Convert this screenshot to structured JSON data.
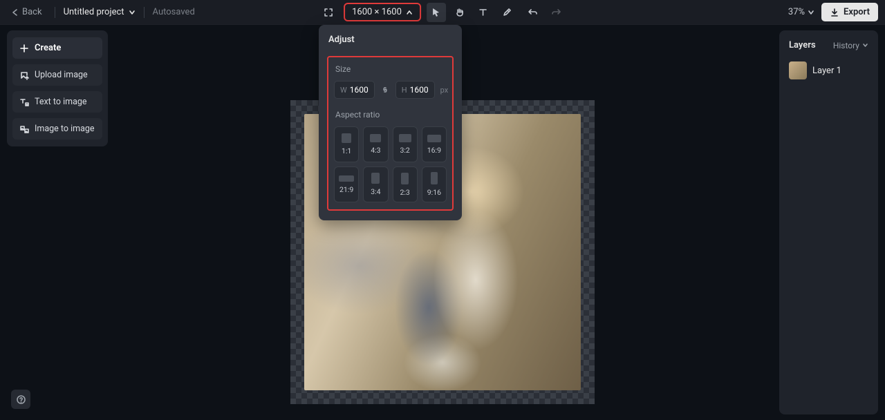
{
  "topbar": {
    "back_label": "Back",
    "project_name": "Untitled project",
    "autosaved_label": "Autosaved",
    "dimensions_label": "1600 × 1600",
    "zoom_label": "37%",
    "export_label": "Export"
  },
  "left_panel": {
    "create_label": "Create",
    "actions": [
      {
        "label": "Upload image"
      },
      {
        "label": "Text to image"
      },
      {
        "label": "Image to image"
      }
    ]
  },
  "right_panel": {
    "title": "Layers",
    "history_label": "History",
    "layers": [
      {
        "name": "Layer 1"
      }
    ]
  },
  "adjust_popover": {
    "title": "Adjust",
    "size_label": "Size",
    "width_label": "W",
    "width_value": "1600",
    "height_label": "H",
    "height_value": "1600",
    "px_label": "px",
    "aspect_ratio_label": "Aspect ratio",
    "ratios": [
      "1:1",
      "4:3",
      "3:2",
      "16:9",
      "21:9",
      "3:4",
      "2:3",
      "9:16"
    ]
  }
}
